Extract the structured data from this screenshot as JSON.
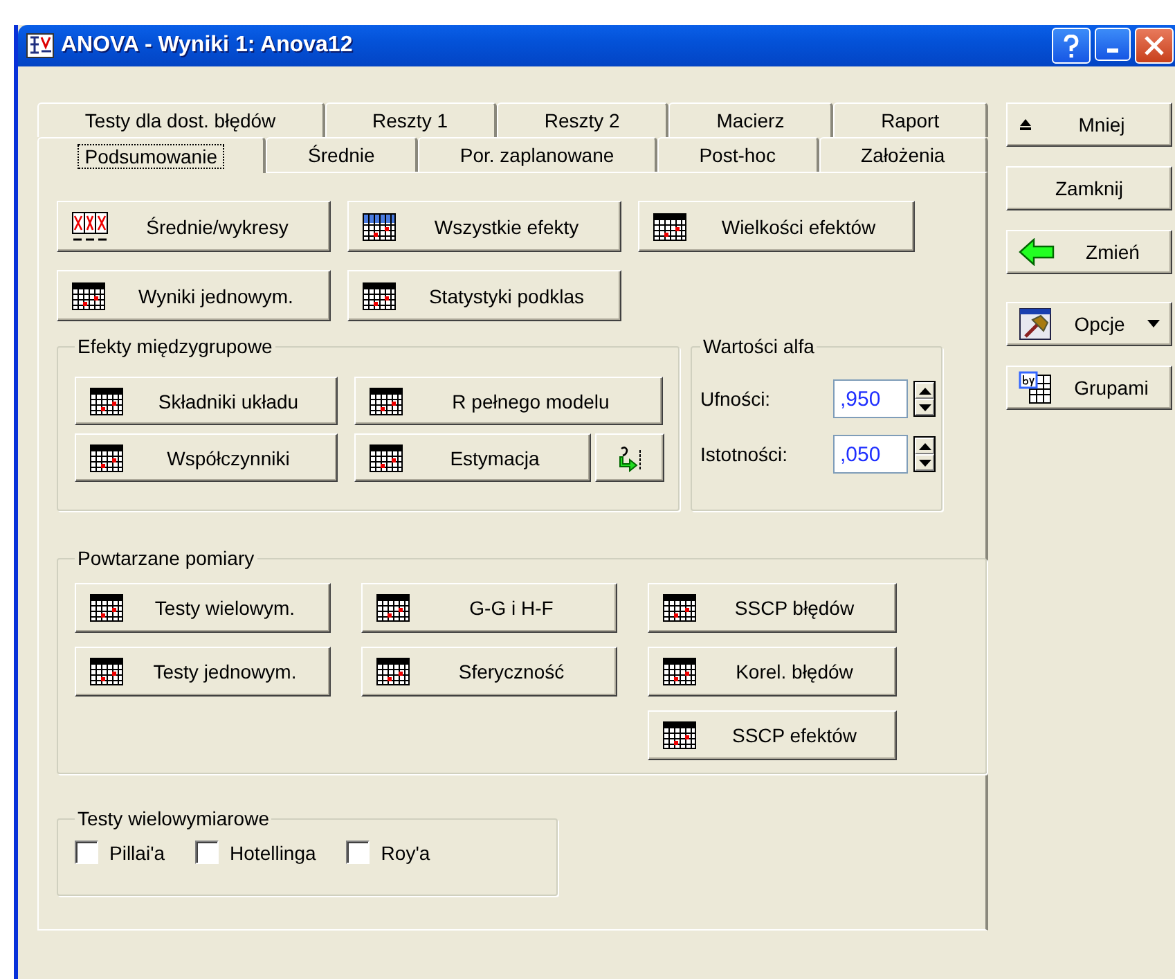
{
  "window": {
    "title": "ANOVA - Wyniki 1: Anova12"
  },
  "tab_rows": [
    [
      {
        "label": "Testy dla dost. błędów",
        "selected": false
      },
      {
        "label": "Reszty 1",
        "selected": false
      },
      {
        "label": "Reszty 2",
        "selected": false
      },
      {
        "label": "Macierz",
        "selected": false
      },
      {
        "label": "Raport",
        "selected": false
      }
    ],
    [
      {
        "label": "Podsumowanie",
        "selected": true
      },
      {
        "label": "Średnie",
        "selected": false
      },
      {
        "label": "Por. zaplanowane",
        "selected": false
      },
      {
        "label": "Post-hoc",
        "selected": false
      },
      {
        "label": "Założenia",
        "selected": false
      }
    ]
  ],
  "button_rows": [
    [
      "Średnie/wykresy",
      "Wszystkie efekty",
      "Wielkości efektów"
    ],
    [
      "Wyniki jednowym.",
      "Statystyki podklas"
    ]
  ],
  "between_group": {
    "title": "Efekty międzygrupowe",
    "rows": [
      [
        {
          "kind": "text",
          "label": "Składniki układu"
        },
        {
          "kind": "text",
          "label": "R pełnego modelu"
        }
      ],
      [
        {
          "kind": "text",
          "label": "Współczynniki"
        },
        {
          "kind": "text",
          "label": "Estymacja"
        },
        {
          "kind": "icon"
        }
      ]
    ]
  },
  "alpha": {
    "title": "Wartości alfa",
    "fields": [
      {
        "label": "Ufności:",
        "value": ",950"
      },
      {
        "label": "Istotności:",
        "value": ",050"
      }
    ]
  },
  "repeated": {
    "title": "Powtarzane pomiary",
    "rows": [
      [
        "Testy wielowym.",
        "G-G i H-F",
        "SSCP błędów"
      ],
      [
        "Testy jednowym.",
        "Sferyczność",
        "Korel. błędów"
      ],
      [
        "",
        "",
        "SSCP efektów"
      ]
    ]
  },
  "multivariate": {
    "title": "Testy wielowymiarowe",
    "options": [
      {
        "label": "Pillai'a",
        "checked": false
      },
      {
        "label": "Hotellinga",
        "checked": false
      },
      {
        "label": "Roy'a",
        "checked": false
      }
    ]
  },
  "side_buttons": [
    "Mniej",
    "Zamknij",
    "Zmień",
    "Opcje",
    "Grupami"
  ]
}
